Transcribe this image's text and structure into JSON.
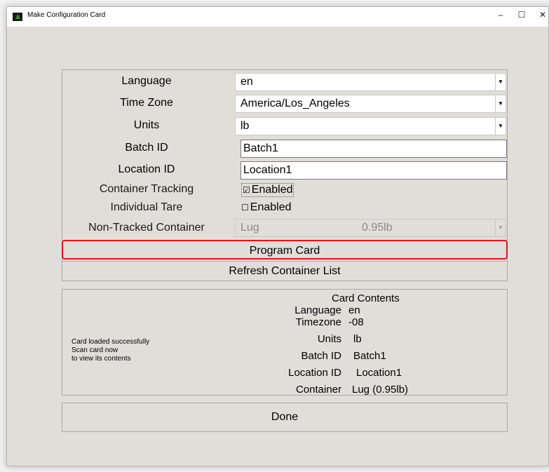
{
  "window": {
    "title": "Make Configuration Card",
    "minimize": "–",
    "maximize": "☐",
    "close": "✕"
  },
  "form": {
    "language": {
      "label": "Language",
      "value": "en"
    },
    "timezone": {
      "label": "Time Zone",
      "value": "America/Los_Angeles"
    },
    "units": {
      "label": "Units",
      "value": "lb"
    },
    "batch": {
      "label": "Batch ID",
      "value": "Batch1"
    },
    "location": {
      "label": "Location ID",
      "value": "Location1"
    },
    "container_tracking": {
      "label": "Container Tracking",
      "option": "Enabled",
      "checked": true,
      "box": "☑"
    },
    "individual_tare": {
      "label": "Individual Tare",
      "option": "Enabled",
      "checked": false,
      "box": "☐"
    },
    "non_tracked": {
      "label": "Non-Tracked Container",
      "name": "Lug",
      "weight": "0.95lb"
    },
    "arrow": "▼",
    "program_button": "Program Card",
    "refresh_button": "Refresh Container List"
  },
  "status": {
    "line1": "Card loaded successfully",
    "line2": "Scan card now",
    "line3": "to view its contents"
  },
  "card": {
    "title": "Card Contents",
    "rows": [
      {
        "key": "Language",
        "value": "en"
      },
      {
        "key": "Timezone",
        "value": "-08"
      },
      {
        "key": "Units",
        "value": "lb"
      },
      {
        "key": "Batch ID",
        "value": "Batch1"
      },
      {
        "key": "Location ID",
        "value": "Location1"
      },
      {
        "key": "Container",
        "value": "Lug (0.95lb)"
      }
    ]
  },
  "done_button": "Done",
  "colors": {
    "highlight": "#e0141c",
    "background": "#e1ded9"
  }
}
